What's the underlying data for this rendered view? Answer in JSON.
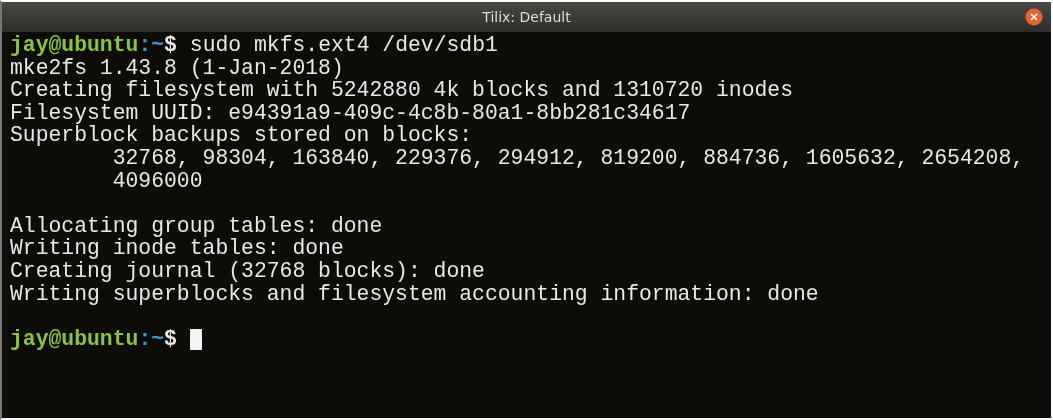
{
  "window": {
    "title": "Tilix: Default"
  },
  "terminal": {
    "lines": [
      {
        "kind": "prompt",
        "user_host": "jay@ubuntu",
        "path": ":~",
        "symbol": "$",
        "command": "sudo mkfs.ext4 /dev/sdb1"
      },
      {
        "kind": "output",
        "text": "mke2fs 1.43.8 (1-Jan-2018)"
      },
      {
        "kind": "output",
        "text": "Creating filesystem with 5242880 4k blocks and 1310720 inodes"
      },
      {
        "kind": "output",
        "text": "Filesystem UUID: e94391a9-409c-4c8b-80a1-8bb281c34617"
      },
      {
        "kind": "output",
        "text": "Superblock backups stored on blocks:"
      },
      {
        "kind": "output",
        "text": "        32768, 98304, 163840, 229376, 294912, 819200, 884736, 1605632, 2654208,"
      },
      {
        "kind": "output",
        "text": "        4096000"
      },
      {
        "kind": "blank"
      },
      {
        "kind": "output",
        "text": "Allocating group tables: done"
      },
      {
        "kind": "output",
        "text": "Writing inode tables: done"
      },
      {
        "kind": "output",
        "text": "Creating journal (32768 blocks): done"
      },
      {
        "kind": "output",
        "text": "Writing superblocks and filesystem accounting information: done"
      },
      {
        "kind": "blank"
      },
      {
        "kind": "prompt",
        "user_host": "jay@ubuntu",
        "path": ":~",
        "symbol": "$",
        "cursor": true
      }
    ]
  }
}
